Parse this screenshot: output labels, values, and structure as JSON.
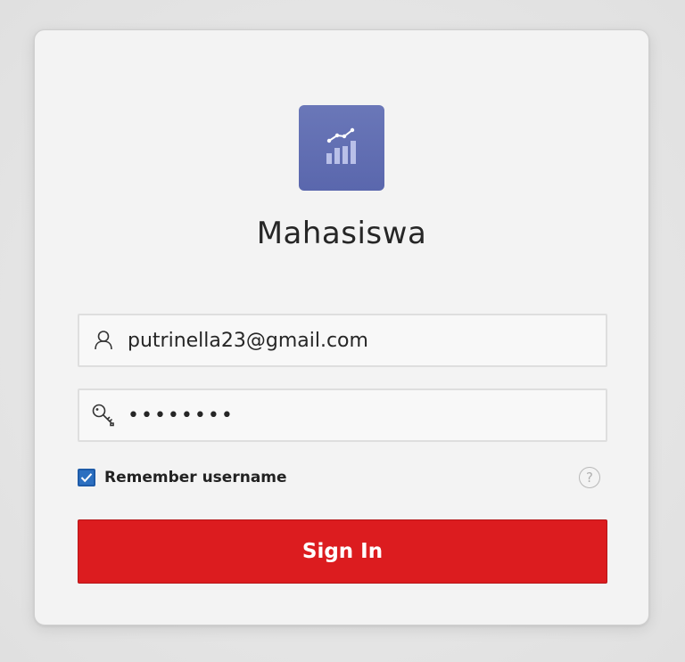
{
  "app": {
    "title": "Mahasiswa",
    "logo_icon": "chart-growth-icon",
    "logo_color": "#6270b3"
  },
  "form": {
    "username": {
      "value": "putrinella23@gmail.com",
      "icon": "user-icon"
    },
    "password": {
      "value": "••••••••",
      "icon": "key-icon"
    },
    "remember": {
      "label": "Remember username",
      "checked": true
    },
    "help_label": "?",
    "submit_label": "Sign In"
  },
  "colors": {
    "accent": "#dc1c1f",
    "checkbox": "#2c6fc0"
  }
}
